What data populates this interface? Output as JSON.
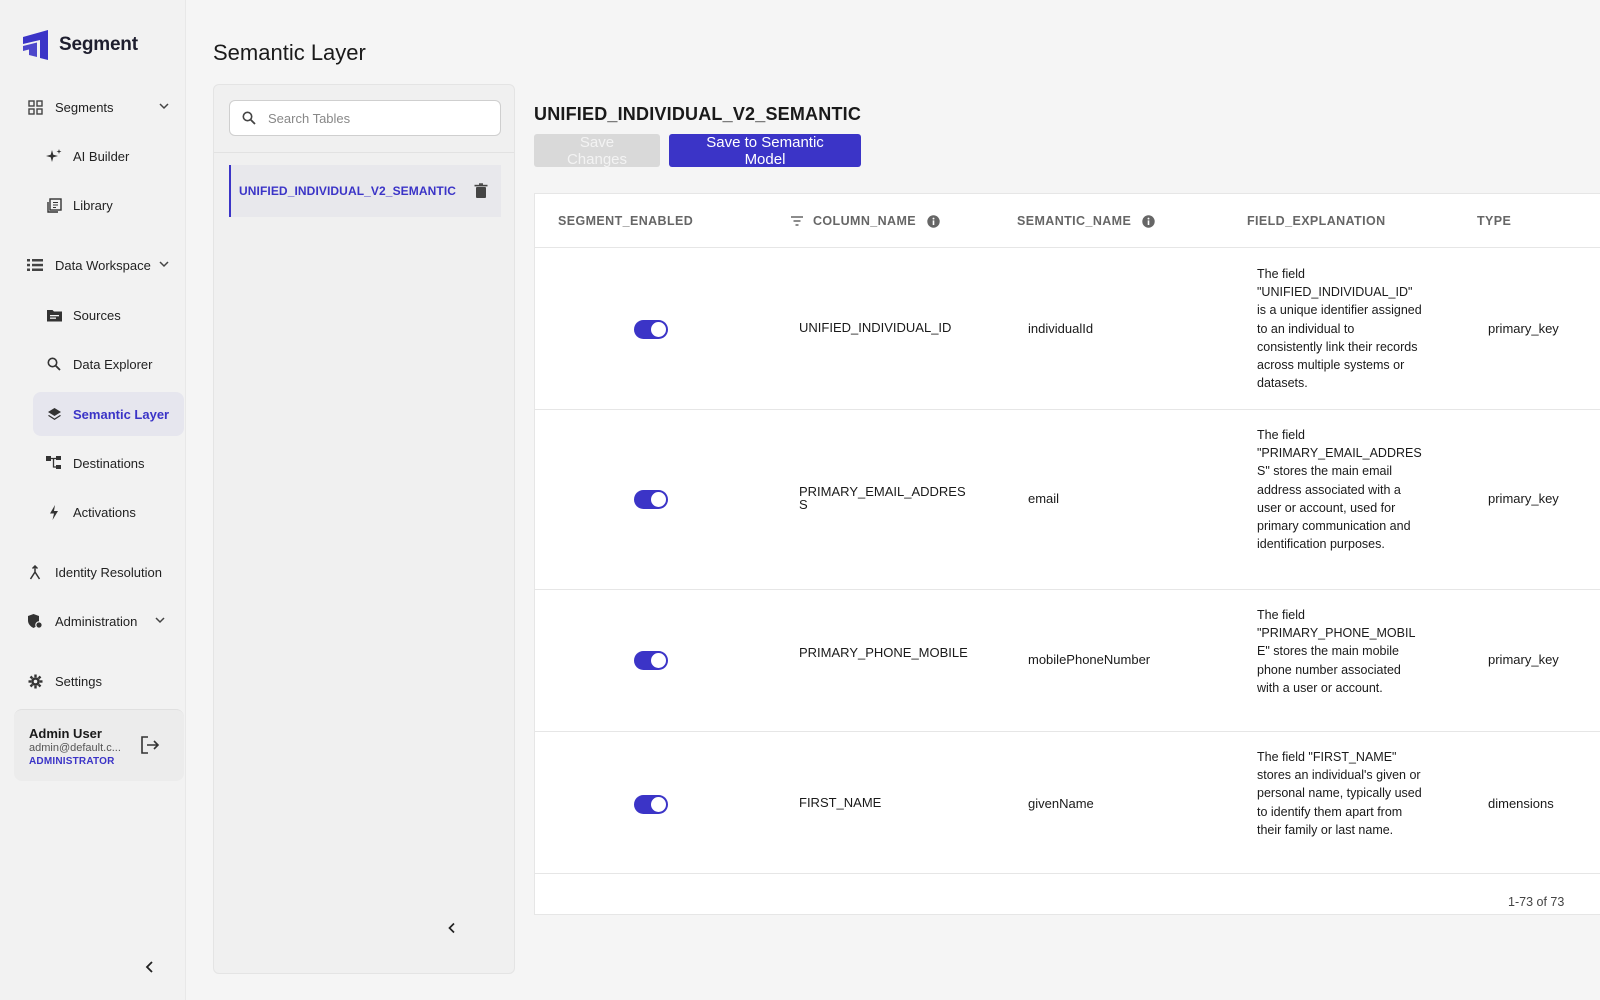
{
  "app": {
    "name": "Segment"
  },
  "sidebar": {
    "items": [
      {
        "key": "segments",
        "label": "Segments"
      },
      {
        "key": "ai-builder",
        "label": "AI Builder"
      },
      {
        "key": "library",
        "label": "Library"
      },
      {
        "key": "data-workspace",
        "label": "Data Workspace"
      },
      {
        "key": "sources",
        "label": "Sources"
      },
      {
        "key": "data-explorer",
        "label": "Data Explorer"
      },
      {
        "key": "semantic-layer",
        "label": "Semantic Layer",
        "active": true
      },
      {
        "key": "destinations",
        "label": "Destinations"
      },
      {
        "key": "activations",
        "label": "Activations"
      },
      {
        "key": "identity-resolution",
        "label": "Identity Resolution"
      },
      {
        "key": "administration",
        "label": "Administration"
      },
      {
        "key": "settings",
        "label": "Settings"
      }
    ],
    "user": {
      "name": "Admin User",
      "email": "admin@default.c...",
      "role": "ADMINISTRATOR"
    }
  },
  "page": {
    "title": "Semantic Layer"
  },
  "tables_panel": {
    "search_placeholder": "Search Tables",
    "tables": [
      {
        "label": "UNIFIED_INDIVIDUAL_V2_SEMANTIC",
        "selected": true
      }
    ]
  },
  "main": {
    "table_title": "UNIFIED_INDIVIDUAL_V2_SEMANTIC",
    "save_changes_label": "Save Changes",
    "save_model_label": "Save to Semantic Model",
    "columns": {
      "segment_enabled": "SEGMENT_ENABLED",
      "column_name": "COLUMN_NAME",
      "semantic_name": "SEMANTIC_NAME",
      "field_explanation": "FIELD_EXPLANATION",
      "type": "TYPE"
    },
    "rows": [
      {
        "enabled": true,
        "column_name": "UNIFIED_INDIVIDUAL_ID",
        "semantic_name": "individualId",
        "field_explanation": "The field \"UNIFIED_INDIVIDUAL_ID\" is a unique identifier assigned to an individual to consistently link their records across multiple systems or datasets.",
        "type": "primary_key"
      },
      {
        "enabled": true,
        "column_name": "PRIMARY_EMAIL_ADDRESS",
        "semantic_name": "email",
        "field_explanation": "The field \"PRIMARY_EMAIL_ADDRESS\" stores the main email address associated with a user or account, used for primary communication and identification purposes.",
        "type": "primary_key"
      },
      {
        "enabled": true,
        "column_name": "PRIMARY_PHONE_MOBILE",
        "semantic_name": "mobilePhoneNumber",
        "field_explanation": "The field \"PRIMARY_PHONE_MOBILE\" stores the main mobile phone number associated with a user or account.",
        "type": "primary_key"
      },
      {
        "enabled": true,
        "column_name": "FIRST_NAME",
        "semantic_name": "givenName",
        "field_explanation": "The field \"FIRST_NAME\" stores an individual's given or personal name, typically used to identify them apart from their family or last name.",
        "type": "dimensions"
      }
    ],
    "pagination": "1-73 of 73"
  },
  "colors": {
    "accent": "#3b34c7",
    "active_bg": "#e6e6ee"
  }
}
